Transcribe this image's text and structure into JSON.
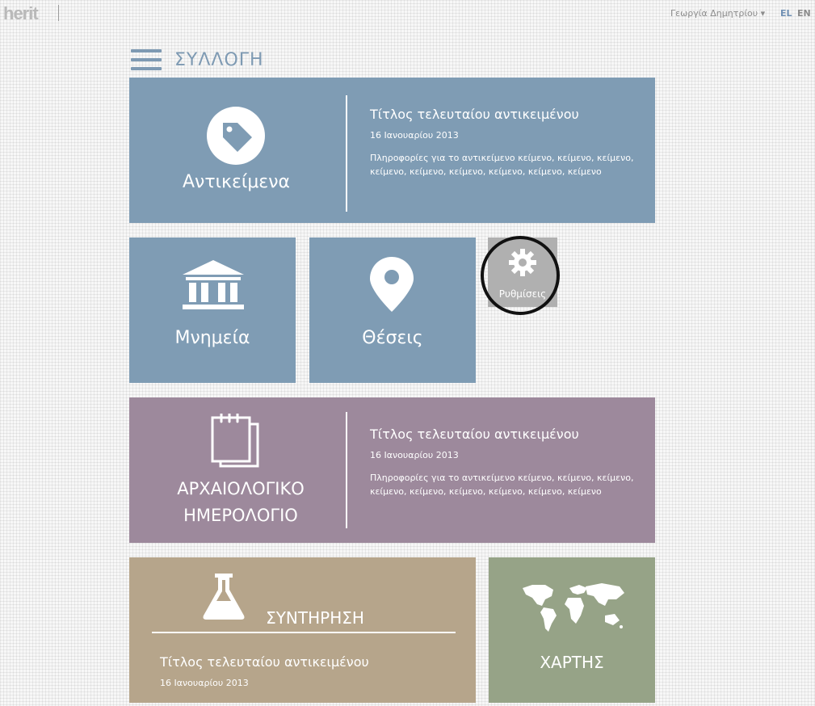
{
  "header": {
    "logo": "herit",
    "user_name": "Γεωργία Δημητρίου ▾",
    "lang_el": "EL",
    "lang_en": "EN"
  },
  "section": {
    "title": "ΣΥΛΛΟΓΗ"
  },
  "tiles": {
    "objects": {
      "label": "Αντικείμενα",
      "icon": "tag-icon",
      "latest_title": "Τίτλος τελευταίου αντικειμένου",
      "latest_date": "16 Ιανουαρίου 2013",
      "latest_info": "Πληροφορίες για το αντικείμενο κείμενο, κείμενο, κείμενο, κείμενο, κείμενο, κείμενο, κείμενο, κείμενο, κείμενο"
    },
    "monuments": {
      "label": "Μνημεία",
      "icon": "museum-icon"
    },
    "places": {
      "label": "Θέσεις",
      "icon": "map-pin-icon"
    },
    "settings": {
      "label": "Ρυθμίσεις",
      "icon": "gear-icon"
    },
    "diary": {
      "label_line1": "ΑΡΧΑΙΟΛΟΓΙΚΟ",
      "label_line2": "ΗΜΕΡΟΛΟΓΙΟ",
      "icon": "notepad-icon",
      "latest_title": "Τίτλος τελευταίου αντικειμένου",
      "latest_date": "16 Ιανουαρίου 2013",
      "latest_info": "Πληροφορίες για το αντικείμενο κείμενο, κείμενο, κείμενο, κείμενο, κείμενο, κείμενο, κείμενο, κείμενο, κείμενο"
    },
    "conservation": {
      "label": "ΣΥΝΤΗΡΗΣΗ",
      "icon": "flask-icon",
      "latest_title": "Τίτλος τελευταίου αντικειμένου",
      "latest_date": "16 Ιανουαρίου 2013"
    },
    "map": {
      "label": "ΧΑΡΤΗΣ",
      "icon": "world-map-icon"
    }
  },
  "colors": {
    "blue": "#7f9cb4",
    "purple": "#9d899c",
    "tan": "#b6a58b",
    "green": "#96a387",
    "settings_gray": "#b0b0b0"
  }
}
